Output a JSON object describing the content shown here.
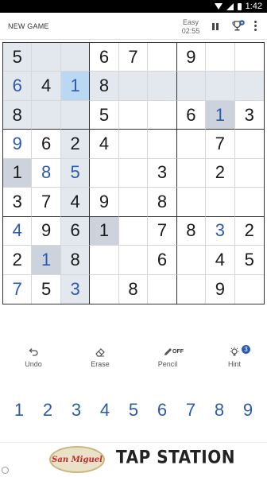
{
  "status_bar": {
    "time": "1:42"
  },
  "header": {
    "new_game_label": "NEW GAME",
    "difficulty": "Easy",
    "timer": "02:55",
    "icons": [
      "pause-icon",
      "trophy-icon",
      "more-vert-icon"
    ]
  },
  "board": {
    "rows": [
      [
        "5",
        "",
        "",
        "6",
        "7",
        "",
        "9",
        "",
        ""
      ],
      [
        "6",
        "4",
        "1",
        "8",
        "",
        "",
        "",
        "",
        ""
      ],
      [
        "8",
        "",
        "",
        "5",
        "",
        "",
        "6",
        "1",
        "3"
      ],
      [
        "9",
        "6",
        "2",
        "4",
        "",
        "",
        "",
        "7",
        ""
      ],
      [
        "1",
        "8",
        "5",
        "",
        "",
        "3",
        "",
        "2",
        ""
      ],
      [
        "3",
        "7",
        "4",
        "9",
        "",
        "8",
        "",
        "",
        ""
      ],
      [
        "4",
        "9",
        "6",
        "1",
        "",
        "7",
        "8",
        "3",
        "2"
      ],
      [
        "2",
        "1",
        "8",
        "",
        "",
        "6",
        "",
        "4",
        "5"
      ],
      [
        "7",
        "5",
        "3",
        "",
        "8",
        "",
        "",
        "9",
        ""
      ]
    ],
    "user_entered": [
      [
        1,
        0
      ],
      [
        1,
        2
      ],
      [
        2,
        7
      ],
      [
        3,
        0
      ],
      [
        4,
        1
      ],
      [
        4,
        2
      ],
      [
        6,
        0
      ],
      [
        6,
        7
      ],
      [
        7,
        1
      ],
      [
        8,
        0
      ],
      [
        8,
        2
      ]
    ],
    "selected_cell": [
      1,
      2
    ],
    "highlight_color": "#e3e7ee",
    "same_number_color": "#cdd3dd",
    "selected_color": "#bbd8f3",
    "user_digit_color": "#2b5bb0"
  },
  "tools": {
    "undo": {
      "label": "Undo",
      "icon": "undo-icon"
    },
    "erase": {
      "label": "Erase",
      "icon": "eraser-icon"
    },
    "pencil": {
      "label": "Pencil",
      "icon": "pencil-icon",
      "state": "OFF"
    },
    "hint": {
      "label": "Hint",
      "icon": "lightbulb-icon",
      "count": "3"
    }
  },
  "numpad": [
    "1",
    "2",
    "3",
    "4",
    "5",
    "6",
    "7",
    "8",
    "9"
  ],
  "ad": {
    "brand": "San Miguel",
    "title": "TAP STATION"
  }
}
